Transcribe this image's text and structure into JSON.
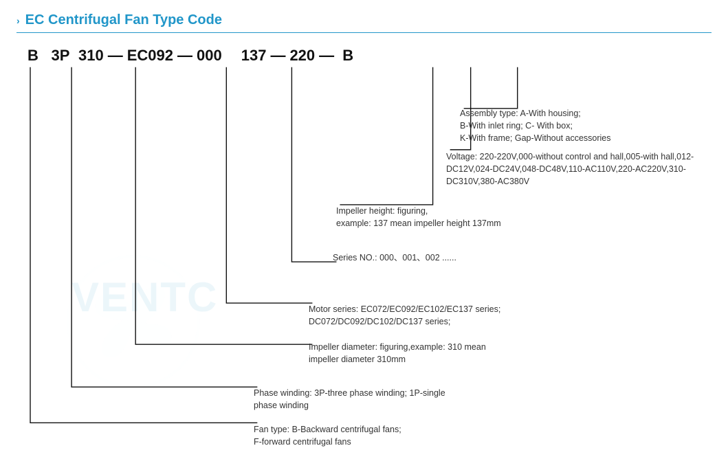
{
  "title": {
    "chevron": "›",
    "label": "EC Centrifugal Fan Type Code"
  },
  "code": {
    "parts": [
      "B",
      "3P",
      "310",
      "EC092",
      "000",
      "137",
      "220",
      "B"
    ],
    "dashes": [
      "—",
      "—",
      "—",
      "—",
      "—",
      "—"
    ]
  },
  "descriptions": [
    {
      "id": "assembly",
      "text": "Assembly type:  A-With housing;\nB-With inlet ring;  C- With box;\nK-With frame; Gap-Without accessories"
    },
    {
      "id": "voltage",
      "text": "Voltage:  220-220V,000-without control and hall,005-with hall,012-DC12V,024-DC24V,048-DC48V,110-AC110V,220-AC220V,310-DC310V,380-AC380V"
    },
    {
      "id": "impeller-height",
      "text": "Impeller height:   figuring,\nexample: 137 mean impeller height 137mm"
    },
    {
      "id": "series-no",
      "text": "Series NO.:  000、001、002 ......"
    },
    {
      "id": "motor-series",
      "text": "Motor series:  EC072/EC092/EC102/EC137 series;\nDC072/DC092/DC102/DC137 series;"
    },
    {
      "id": "impeller-dia",
      "text": "Impeller diameter:  figuring,example: 310 mean\nimpeller diameter 310mm"
    },
    {
      "id": "phase",
      "text": "Phase winding:  3P-three phase winding;  1P-single\nphase winding"
    },
    {
      "id": "fan-type",
      "text": "Fan type:  B-Backward centrifugal fans;\nF-forward centrifugal fans"
    }
  ],
  "watermark_text": "VENTC"
}
